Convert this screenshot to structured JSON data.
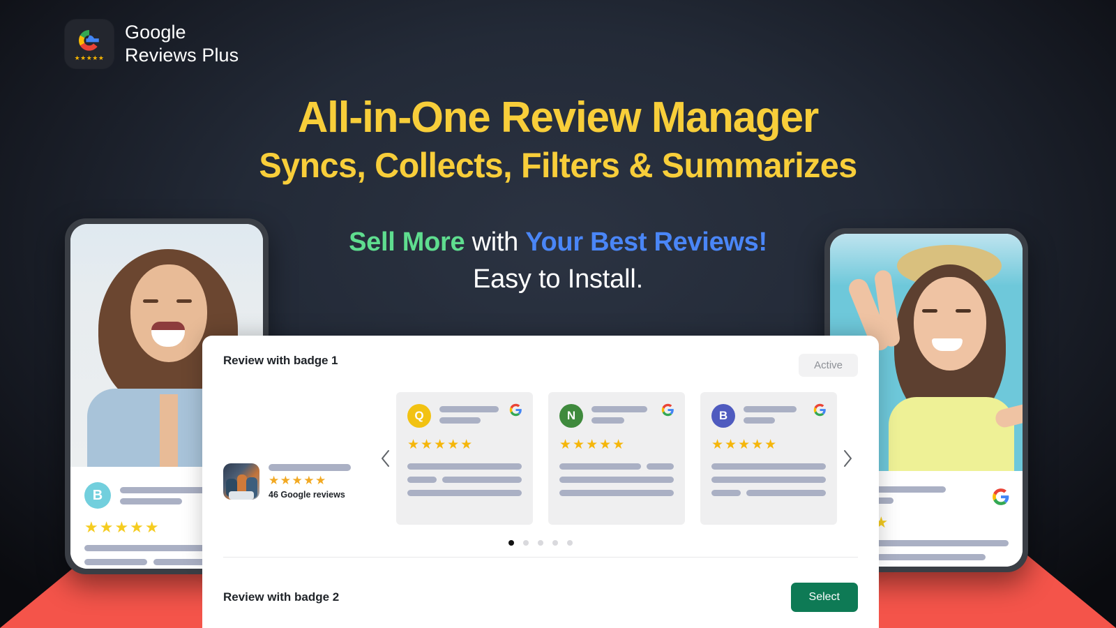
{
  "brand": {
    "logo_icon": "google-e-logo-icon",
    "stars": "★★★★★",
    "line1": "Google",
    "line2": "Reviews Plus"
  },
  "colors": {
    "background": "#232a37",
    "accent_yellow": "#f8ce3a",
    "accent_green": "#5fdd8f",
    "accent_blue": "#4a86f7",
    "accent_red": "#f4544a",
    "button_green": "#0e7a55",
    "star_gold": "#f5b60b"
  },
  "headline": {
    "line1": "All-in-One Review Manager",
    "line2": "Syncs, Collects, Filters & Summarizes"
  },
  "subhead": {
    "sell": "Sell More",
    "with": " with ",
    "best": "Your Best Reviews!",
    "line2": "Easy to Install."
  },
  "panel": {
    "title": "Review with badge 1",
    "status_badge": "Active",
    "prev_icon": "chevron-left-icon",
    "next_icon": "chevron-right-icon",
    "badge_widget": {
      "thumb_icon": "business-photo-thumbnail",
      "stars": "★★★★★",
      "review_count_label": "46 Google reviews"
    },
    "review_cards": [
      {
        "initial": "Q",
        "avatar_color": "#f2c212",
        "stars": "★★★★★",
        "google_icon": "google-g-icon"
      },
      {
        "initial": "N",
        "avatar_color": "#3f8a3d",
        "stars": "★★★★★",
        "google_icon": "google-g-icon"
      },
      {
        "initial": "B",
        "avatar_color": "#4f5bbf",
        "stars": "★★★★★",
        "google_icon": "google-g-icon"
      }
    ],
    "dots": {
      "count": 5,
      "active_index": 0
    }
  },
  "bottom": {
    "title": "Review with badge 2",
    "select_label": "Select"
  },
  "phone_left": {
    "photo_alt": "smiling-woman-denim-shirt-photo",
    "widget": {
      "initial": "B",
      "avatar_color": "#72cfdd",
      "stars": "★★★★★"
    }
  },
  "phone_right": {
    "photo_alt": "smiling-woman-hat-peace-sign-photo",
    "widget": {
      "stars": "★★★",
      "google_icon": "google-g-icon"
    }
  }
}
